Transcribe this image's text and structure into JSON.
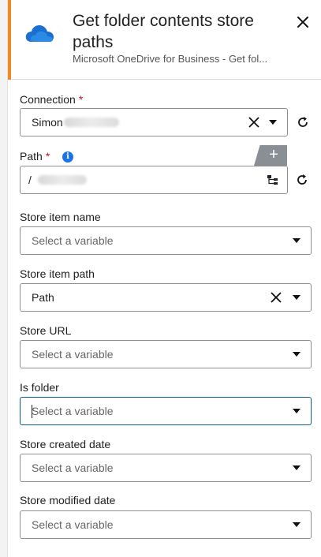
{
  "header": {
    "title": "Get folder contents store paths",
    "subtitle": "Microsoft OneDrive for Business - Get fol...",
    "close_icon": "close-icon",
    "accent_color": "#f08a24",
    "app_icon": "onedrive-cloud-icon"
  },
  "fields": {
    "connection": {
      "label": "Connection",
      "required_mark": "*",
      "value": "Simon"
    },
    "path": {
      "label": "Path",
      "required_mark": "*",
      "info_glyph": "i",
      "value": "/",
      "add_glyph": "+"
    },
    "store_item_name": {
      "label": "Store item name",
      "placeholder": "Select a variable"
    },
    "store_item_path": {
      "label": "Store item path",
      "value": "Path"
    },
    "store_url": {
      "label": "Store URL",
      "placeholder": "Select a variable"
    },
    "is_folder": {
      "label": "Is folder",
      "placeholder": "Select a variable"
    },
    "store_created_date": {
      "label": "Store created date",
      "placeholder": "Select a variable"
    },
    "store_modified_date": {
      "label": "Store modified date",
      "placeholder": "Select a variable"
    }
  }
}
